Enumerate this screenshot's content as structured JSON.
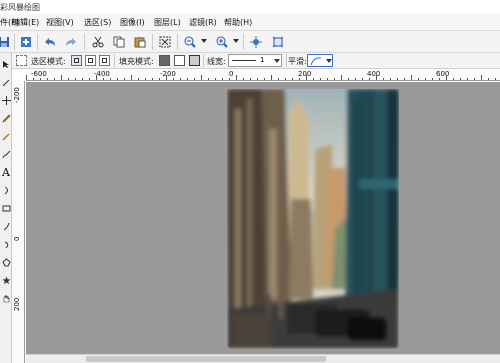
{
  "title_fragment": "彩风暴绘图",
  "menu": [
    {
      "label": "件(F)"
    },
    {
      "label": "编辑(E)"
    },
    {
      "label": "视图(V)"
    },
    {
      "label": "选区(S)"
    },
    {
      "label": "图像(I)"
    },
    {
      "label": "图层(L)"
    },
    {
      "label": "滤镜(R)"
    },
    {
      "label": "帮助(H)"
    }
  ],
  "toolbar_icons": [
    "save-icon",
    "new-layer-icon",
    "undo-icon",
    "redo-icon",
    "cut-icon",
    "copy-icon",
    "paste-icon",
    "deselect-icon",
    "zoom-out-icon",
    "zoom-in-icon",
    "fit-window-icon",
    "actual-size-icon"
  ],
  "options": {
    "selection_mode_label": "选区模式:",
    "fill_mode_label": "填充模式:",
    "line_width_label": "线宽:",
    "line_width_value": "1",
    "smooth_label": "平滑:"
  },
  "ruler_h": [
    "-600",
    "-400",
    "-200",
    "0",
    "200",
    "400",
    "600"
  ],
  "ruler_v": [
    "-200",
    "0",
    "200"
  ],
  "tools": [
    "selection-arrow-icon",
    "magic-wand-icon",
    "move-icon",
    "pencil-icon",
    "brush-icon",
    "paint-brush-icon",
    "text-tool-icon",
    "curve-tool-icon",
    "rectangle-tool-icon",
    "line-tool-icon",
    "ellipse-tool-icon",
    "polygon-tool-icon",
    "star-tool-icon",
    "hand-tool-icon"
  ],
  "colors": {
    "canvas_bg": "#9a9a9a",
    "accent": "#3a6fd0"
  }
}
